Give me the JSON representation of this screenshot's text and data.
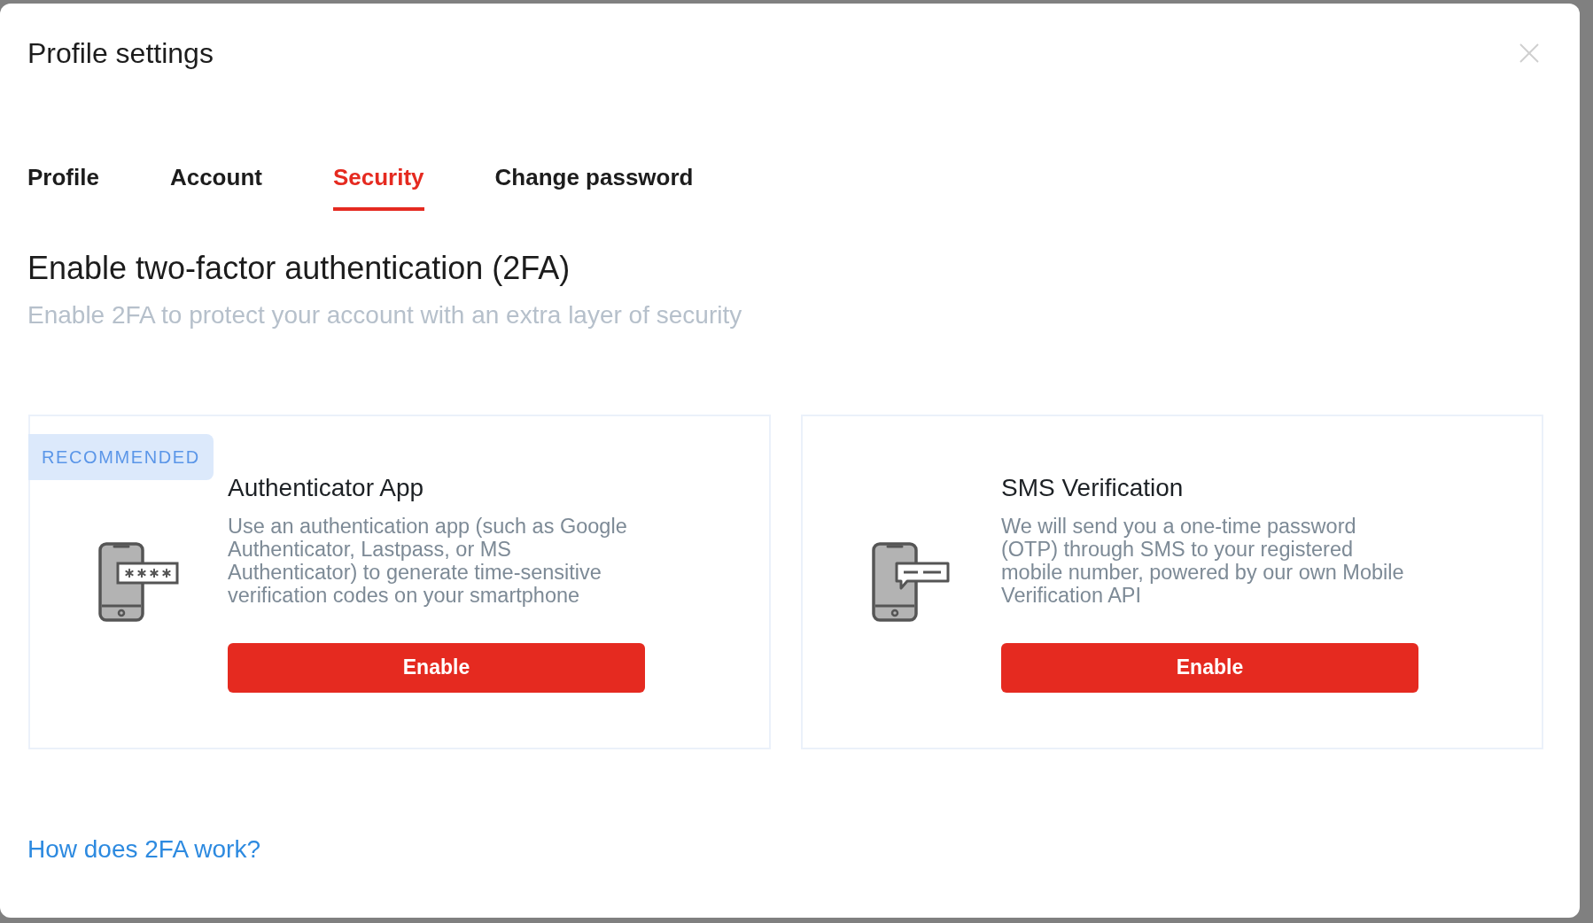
{
  "dialog": {
    "title": "Profile settings"
  },
  "tabs": [
    {
      "label": "Profile",
      "selected": false
    },
    {
      "label": "Account",
      "selected": false
    },
    {
      "label": "Security",
      "selected": true
    },
    {
      "label": "Change password",
      "selected": false
    }
  ],
  "section": {
    "heading": "Enable two-factor authentication (2FA)",
    "subheading": "Enable 2FA to protect your account with an extra layer of security"
  },
  "methods": [
    {
      "kind": "app",
      "badge": "RECOMMENDED",
      "title": "Authenticator App",
      "description": "Use an authentication app (such as Google Authenticator, Lastpass, or MS Authenticator) to generate time-sensitive verification codes on your smartphone",
      "button": "Enable"
    },
    {
      "kind": "sms",
      "title": "SMS Verification",
      "description": "We will send you a one-time password (OTP) through SMS to your registered mobile number, powered by our own Mobile Verification API",
      "button": "Enable"
    }
  ],
  "help_link": "How does 2FA work?"
}
